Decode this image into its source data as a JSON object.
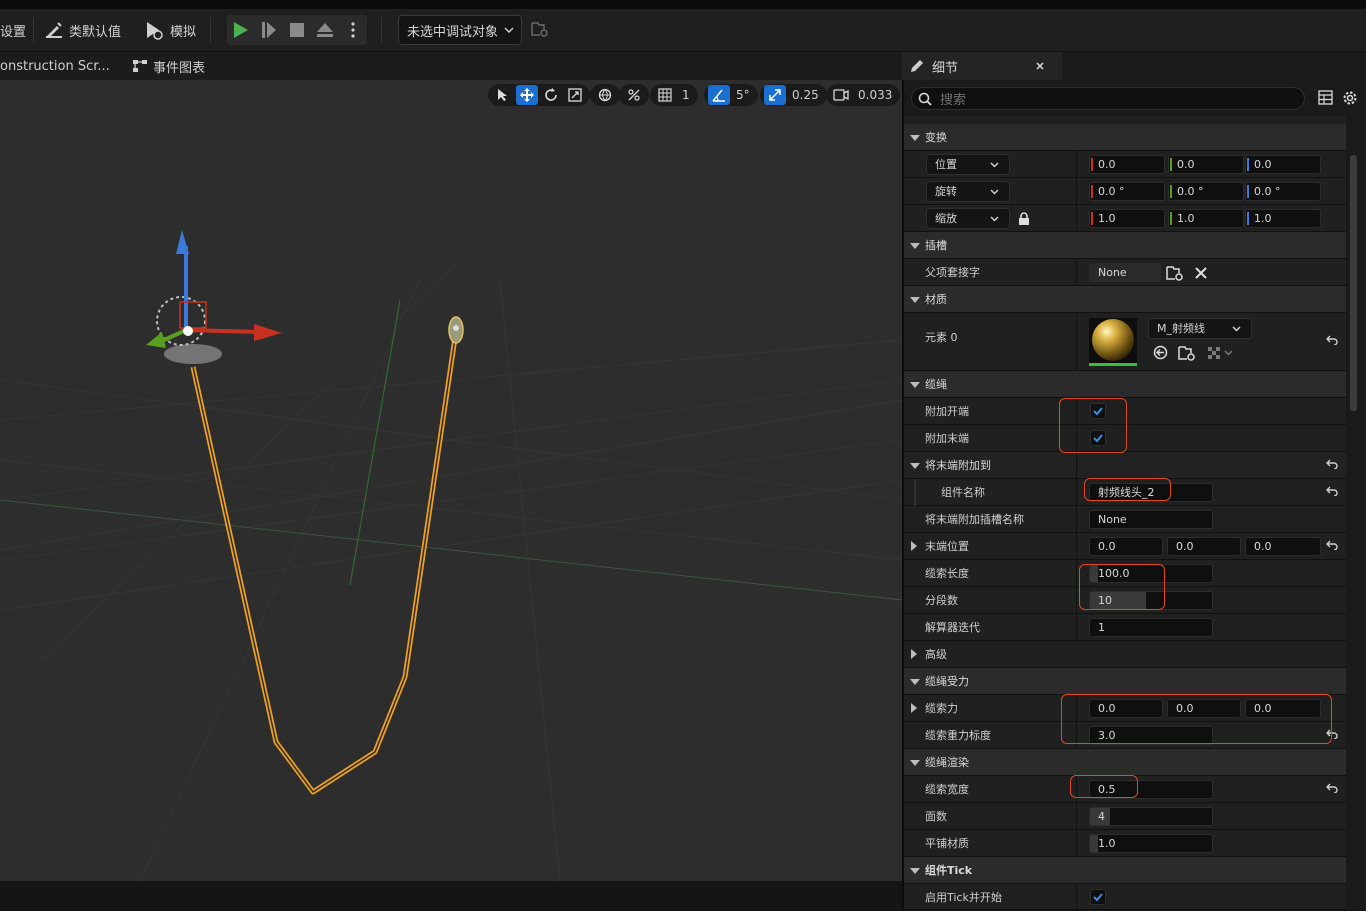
{
  "toolbar": {
    "settings_label": "设置",
    "defaults_label": "类默认值",
    "simulate_label": "模拟",
    "debug_target": "未选中调试对象"
  },
  "tabs": {
    "construction": "onstruction Scr...",
    "event_graph": "事件图表"
  },
  "viewport_tools": {
    "grid_value": "1",
    "angle_value": "5°",
    "scale_value": "0.25",
    "camera_value": "0.033"
  },
  "details": {
    "tab_title": "细节",
    "search_placeholder": "搜索",
    "transform": {
      "category": "变换",
      "location_label": "位置",
      "rotation_label": "旋转",
      "scale_label": "缩放",
      "location": [
        "0.0",
        "0.0",
        "0.0"
      ],
      "rotation": [
        "0.0 °",
        "0.0 °",
        "0.0 °"
      ],
      "scale": [
        "1.0",
        "1.0",
        "1.0"
      ]
    },
    "socket": {
      "category": "插槽",
      "parent_socket_label": "父项套接字",
      "parent_socket_value": "None"
    },
    "material": {
      "category": "材质",
      "element_label": "元素 0",
      "material_name": "M_射频线"
    },
    "cable": {
      "category": "缆绳",
      "attach_start_label": "附加开端",
      "attach_end_label": "附加末端",
      "attach_end_to_label": "将末端附加到",
      "component_name_label": "组件名称",
      "component_name_value": "射频线头_2",
      "end_socket_label": "将末端附加插槽名称",
      "end_socket_value": "None",
      "end_location_label": "末端位置",
      "end_location": [
        "0.0",
        "0.0",
        "0.0"
      ],
      "cable_length_label": "缆索长度",
      "cable_length_value": "100.0",
      "segments_label": "分段数",
      "segments_value": "10",
      "solver_iter_label": "解算器迭代",
      "solver_iter_value": "1",
      "advanced_label": "高级"
    },
    "forces": {
      "category": "缆绳受力",
      "force_label": "缆索力",
      "force": [
        "0.0",
        "0.0",
        "0.0"
      ],
      "gravity_label": "缆索重力标度",
      "gravity_value": "3.0"
    },
    "rendering": {
      "category": "缆绳渲染",
      "width_label": "缆索宽度",
      "width_value": "0.5",
      "sides_label": "面数",
      "sides_value": "4",
      "tile_label": "平铺材质",
      "tile_value": "1.0"
    },
    "tick": {
      "category": "组件Tick",
      "start_label": "启用Tick并开始"
    }
  },
  "colors": {
    "accent": "#1a6fd0",
    "highlight_box": "#e04a1c",
    "cable": "#f0a020",
    "play_green": "#4caf50"
  }
}
